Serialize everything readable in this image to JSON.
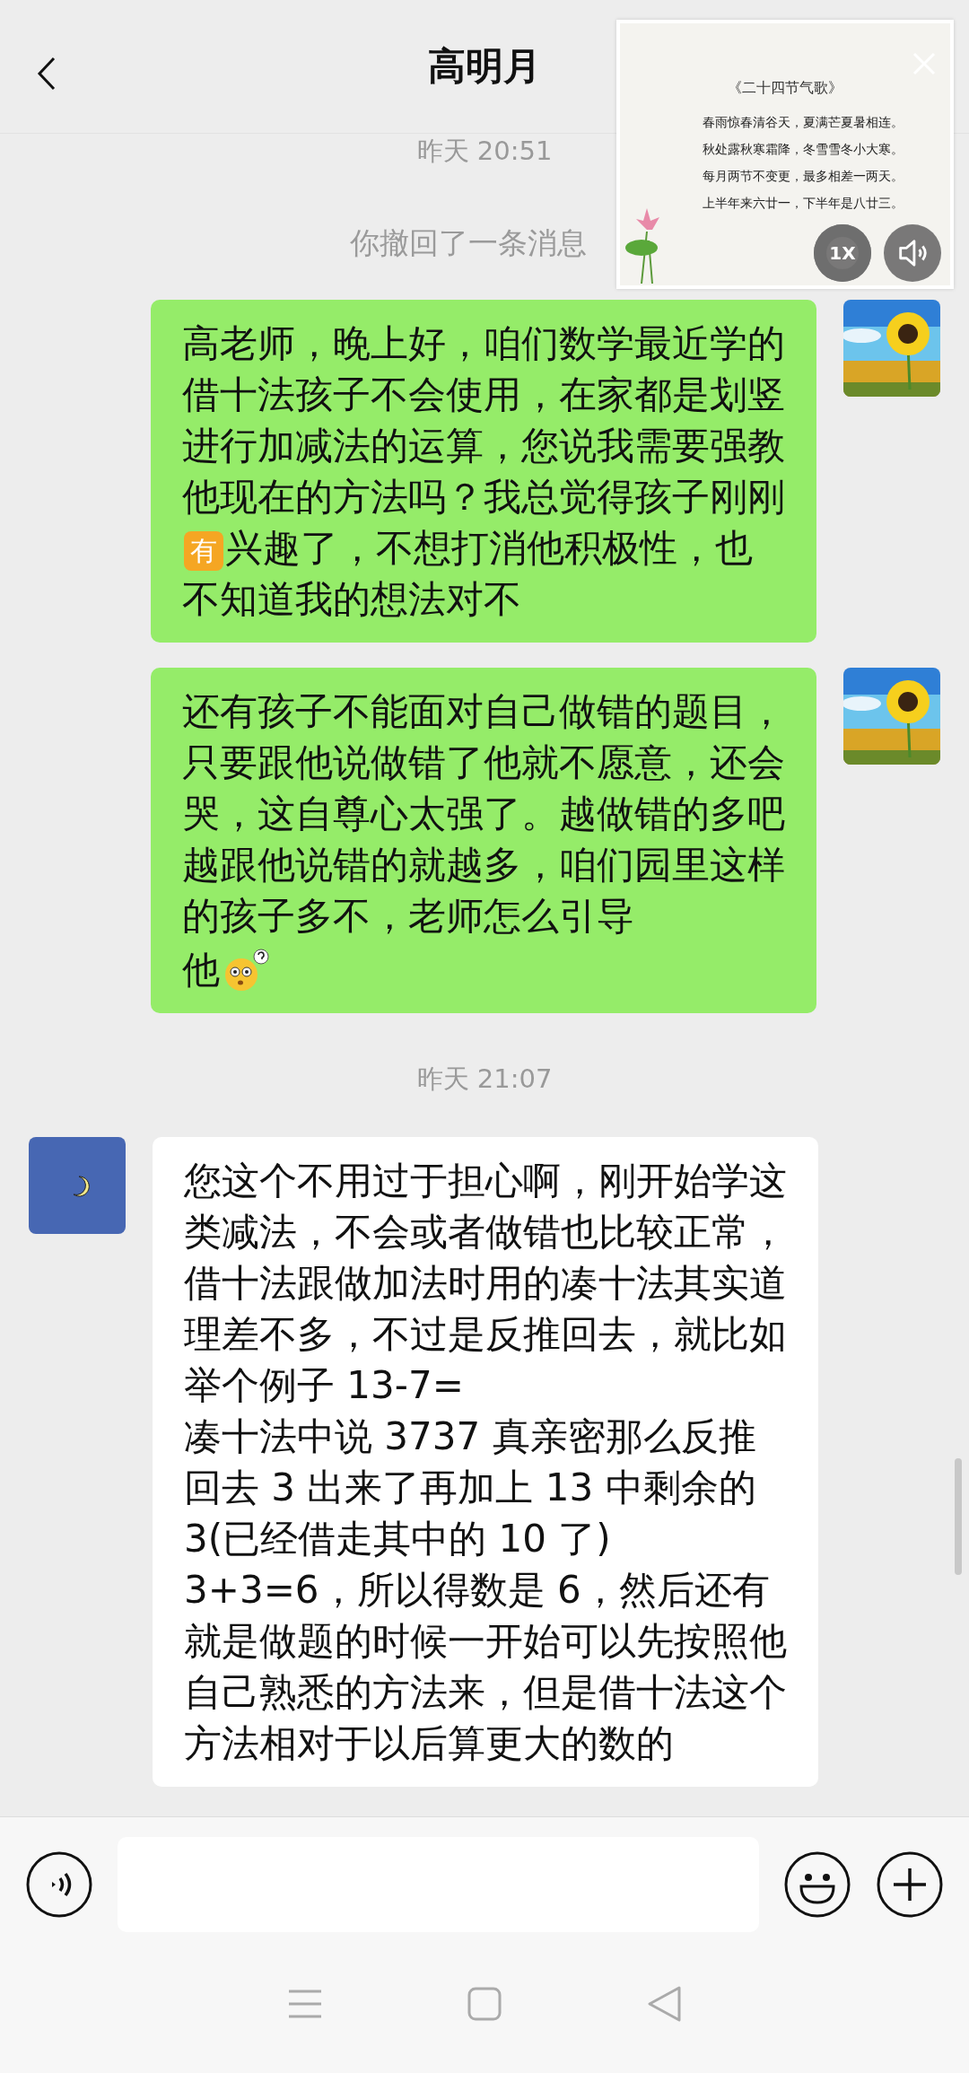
{
  "header": {
    "title": "高明月"
  },
  "floating_window": {
    "title": "《二十四节气歌》",
    "lines": [
      "春雨惊春清谷天，夏满芒夏暑相连。",
      "秋处露秋寒霜降，冬雪雪冬小大寒。",
      "每月两节不变更，最多相差一两天。",
      "上半年来六廿一，下半年是八廿三。"
    ],
    "speed": "1X"
  },
  "messages": [
    {
      "kind": "time",
      "text": "昨天 20:51"
    },
    {
      "kind": "notice",
      "text": "你撤回了一条消息"
    },
    {
      "kind": "outgoing",
      "blocks": [
        {
          "kind": "paragraph",
          "parts": [
            {
              "kind": "text",
              "text": "高老师，晚上好，咱们数学最近学的借十法孩子不会使用，在家都是划竖进行加减法的运算，您说我需要强教他现在的方法吗？我总觉得孩子刚刚"
            },
            {
              "kind": "badge",
              "text": "有"
            },
            {
              "kind": "text",
              "text": "兴趣了，不想打消他积极性，也不知道我的想法对不"
            }
          ]
        }
      ]
    },
    {
      "kind": "outgoing",
      "blocks": [
        {
          "kind": "paragraph",
          "parts": [
            {
              "kind": "text",
              "text": "还有孩子不能面对自己做错的题目，只要跟他说做错了他就不愿意，还会哭，这自尊心太强了。越做错的多吧越跟他说错的就越多，咱们园里这样的孩子多不，老师怎么引导"
            }
          ]
        },
        {
          "kind": "paragraph",
          "parts": [
            {
              "kind": "text",
              "text": "他"
            }
          ]
        },
        {
          "kind": "emoji"
        }
      ]
    },
    {
      "kind": "time",
      "text": "昨天 21:07"
    },
    {
      "kind": "incoming",
      "blocks": [
        {
          "kind": "paragraph",
          "parts": [
            {
              "kind": "text",
              "text": "您这个不用过于担心啊，刚开始学这类减法，不会或者做错也比较正常，借十法跟做加法时用的凑十法其实道理差不多，不过是反推回去，就比如举个例子 13-7=\n凑十法中说 3737 真亲密那么反推回去 3 出来了再加上 13 中剩余的3(已经借走其中的 10 了)\n3+3=6，所以得数是 6，然后还有就是做题的时候一开始可以先按照他自己熟悉的方法来，但是借十法这个方法相对于以后算更大的数的"
            }
          ]
        }
      ]
    }
  ]
}
